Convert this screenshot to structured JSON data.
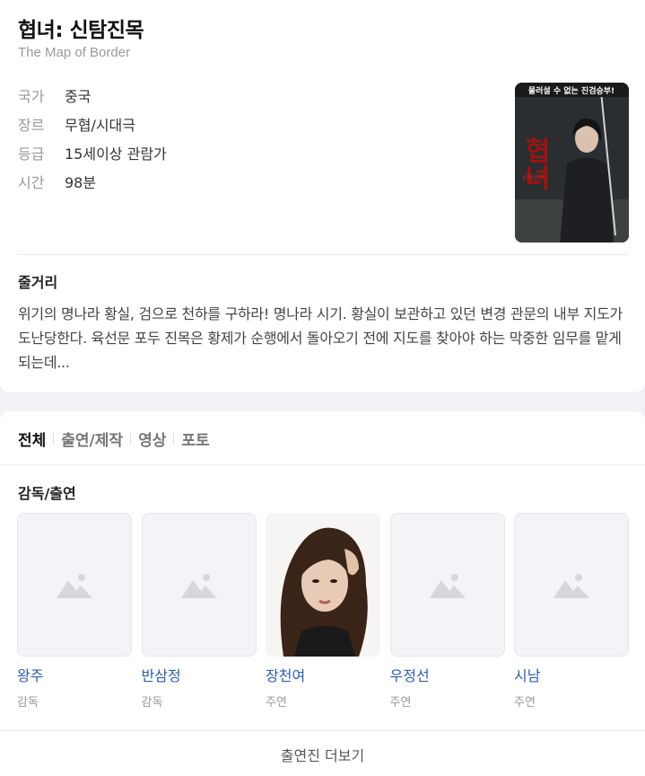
{
  "title": "협녀: 신탐진목",
  "subtitle": "The Map of Border",
  "info": [
    {
      "key": "국가",
      "value": "중국"
    },
    {
      "key": "장르",
      "value": "무협/시대극"
    },
    {
      "key": "등급",
      "value": "15세이상 관람가"
    },
    {
      "key": "시간",
      "value": "98분"
    }
  ],
  "poster": {
    "tagline": "물러설 수 없는 진검승부!",
    "title_chars": "협녀",
    "subtitle_small": "신탐진목"
  },
  "synopsis": {
    "heading": "줄거리",
    "text": "위기의 명나라 황실, 검으로 천하를 구하라! 명나라 시기. 황실이 보관하고 있던 변경 관문의 내부 지도가 도난당한다. 육선문 포두 진목은 황제가 순행에서 돌아오기 전에 지도를 찾아야 하는 막중한 임무를 맡게 되는데..."
  },
  "tabs": [
    "전체",
    "출연/제작",
    "영상",
    "포토"
  ],
  "cast_heading": "감독/출연",
  "cast": [
    {
      "name": "왕주",
      "role": "감독"
    },
    {
      "name": "반삼정",
      "role": "감독"
    },
    {
      "name": "장천여",
      "role": "주연"
    },
    {
      "name": "우정선",
      "role": "주연"
    },
    {
      "name": "시남",
      "role": "주연"
    }
  ],
  "more_label": "출연진 더보기",
  "colors": {
    "link": "#2d5db2",
    "muted": "#999999"
  }
}
